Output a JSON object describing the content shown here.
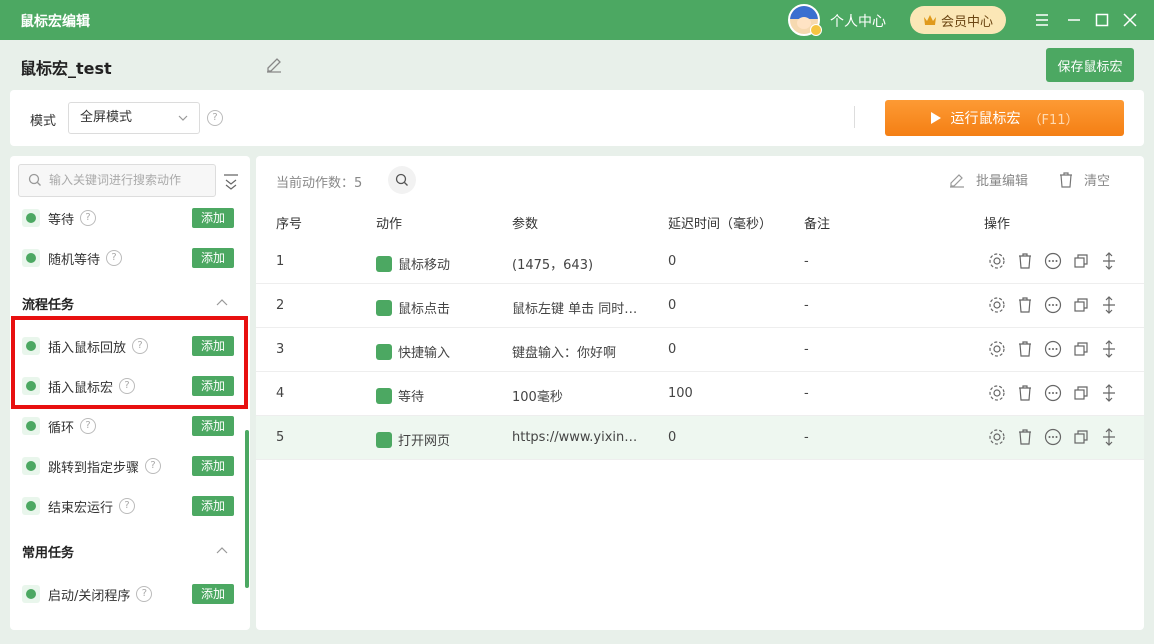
{
  "window": {
    "title": "鼠标宏编辑",
    "user_center": "个人中心",
    "vip_label": "会员中心"
  },
  "header": {
    "macro_name": "鼠标宏_test",
    "save_label": "保存鼠标宏"
  },
  "toolbar": {
    "mode_label": "模式",
    "mode_value": "全屏模式",
    "run_label": "运行鼠标宏",
    "run_hint": "（F11）"
  },
  "sidebar": {
    "search_placeholder": "输入关键词进行搜索动作",
    "add_label": "添加",
    "items_top": [
      {
        "label": "等待"
      },
      {
        "label": "随机等待"
      }
    ],
    "section_flow": "流程任务",
    "items_flow": [
      {
        "label": "插入鼠标回放"
      },
      {
        "label": "插入鼠标宏"
      },
      {
        "label": "循环"
      },
      {
        "label": "跳转到指定步骤"
      },
      {
        "label": "结束宏运行"
      }
    ],
    "section_common": "常用任务",
    "items_common": [
      {
        "label": "启动/关闭程序"
      }
    ]
  },
  "main": {
    "count_label": "当前动作数：5",
    "bulk_edit": "批量编辑",
    "clear": "清空",
    "columns": [
      "序号",
      "动作",
      "参数",
      "延迟时间（毫秒）",
      "备注",
      "操作"
    ],
    "rows": [
      {
        "index": "1",
        "action": "鼠标移动",
        "param": "(1475，643)",
        "delay": "0",
        "note": "-"
      },
      {
        "index": "2",
        "action": "鼠标点击",
        "param": "鼠标左键 单击 同时…",
        "delay": "0",
        "note": "-"
      },
      {
        "index": "3",
        "action": "快捷输入",
        "param": "键盘输入：你好啊",
        "delay": "0",
        "note": "-"
      },
      {
        "index": "4",
        "action": "等待",
        "param": "100毫秒",
        "delay": "100",
        "note": "-"
      },
      {
        "index": "5",
        "action": "打开网页",
        "param": "https://www.yixin…",
        "delay": "0",
        "note": "-"
      }
    ]
  },
  "colors": {
    "brand": "#4ca862",
    "run": "#f47f14",
    "highlight": "#e81010"
  }
}
